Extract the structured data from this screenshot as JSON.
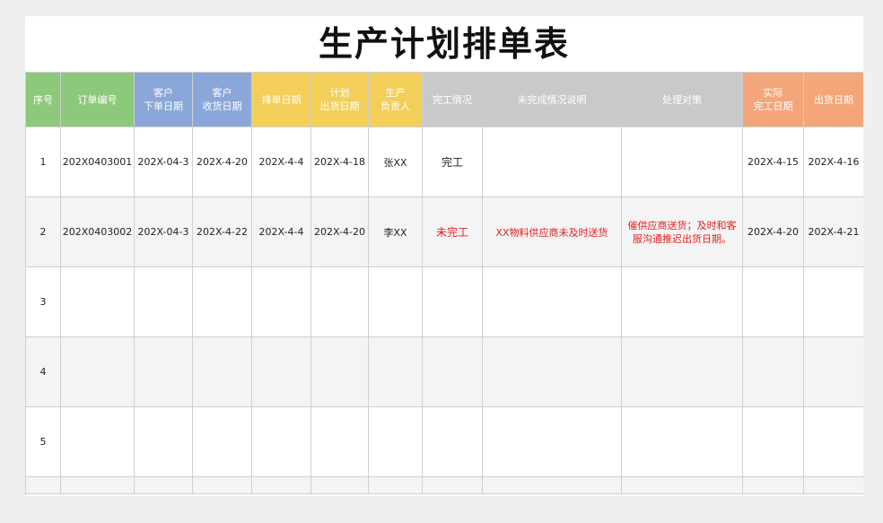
{
  "title": "生产计划排单表",
  "colors": {
    "green": "#8cc97a",
    "blue": "#8aa7d9",
    "yellow": "#f3cf5a",
    "gray": "#c9c9c9",
    "orange": "#f3a679",
    "alert_red": "#e02020"
  },
  "columns": [
    {
      "label": "序号",
      "group": "green"
    },
    {
      "label": "订单编号",
      "group": "green"
    },
    {
      "label": "客户\n下单日期",
      "group": "blue"
    },
    {
      "label": "客户\n收货日期",
      "group": "blue"
    },
    {
      "label": "排单日期",
      "group": "yellow"
    },
    {
      "label": "计划\n出货日期",
      "group": "yellow"
    },
    {
      "label": "生产\n负责人",
      "group": "yellow"
    },
    {
      "label": "完工情况",
      "group": "gray"
    },
    {
      "label": "未完成情况说明",
      "group": "gray"
    },
    {
      "label": "处理对策",
      "group": "gray"
    },
    {
      "label": "实际\n完工日期",
      "group": "orange"
    },
    {
      "label": "出货日期",
      "group": "orange"
    }
  ],
  "rows": [
    {
      "no": "1",
      "order": "202X0403001",
      "order_date": "202X-04-3",
      "receive_date": "202X-4-20",
      "schedule_date": "202X-4-4",
      "plan_ship": "202X-4-18",
      "owner": "张XX",
      "status": "完工",
      "reason": "",
      "measure": "",
      "actual_done": "202X-4-15",
      "ship_date": "202X-4-16"
    },
    {
      "no": "2",
      "order": "202X0403002",
      "order_date": "202X-04-3",
      "receive_date": "202X-4-22",
      "schedule_date": "202X-4-4",
      "plan_ship": "202X-4-20",
      "owner": "李XX",
      "status": "未完工",
      "reason": "XX物料供应商未及时送货",
      "measure": "催供应商送货；及时和客服沟通推迟出货日期。",
      "actual_done": "202X-4-20",
      "ship_date": "202X-4-21"
    },
    {
      "no": "3",
      "order": "",
      "order_date": "",
      "receive_date": "",
      "schedule_date": "",
      "plan_ship": "",
      "owner": "",
      "status": "",
      "reason": "",
      "measure": "",
      "actual_done": "",
      "ship_date": ""
    },
    {
      "no": "4",
      "order": "",
      "order_date": "",
      "receive_date": "",
      "schedule_date": "",
      "plan_ship": "",
      "owner": "",
      "status": "",
      "reason": "",
      "measure": "",
      "actual_done": "",
      "ship_date": ""
    },
    {
      "no": "5",
      "order": "",
      "order_date": "",
      "receive_date": "",
      "schedule_date": "",
      "plan_ship": "",
      "owner": "",
      "status": "",
      "reason": "",
      "measure": "",
      "actual_done": "",
      "ship_date": ""
    }
  ]
}
